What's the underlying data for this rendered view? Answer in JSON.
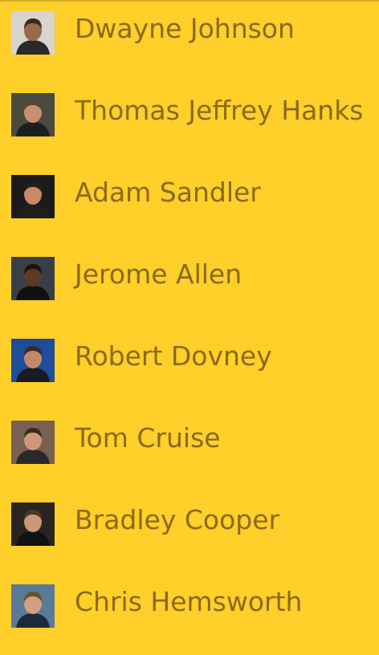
{
  "people": [
    {
      "name": "Dwayne Johnson",
      "bg": "#D8D4CE",
      "skin": "#9A6A4A",
      "hair": "#3A2A22",
      "shirt": "#2A2A2A",
      "avatar_icon": "person-photo-icon"
    },
    {
      "name": "Thomas Jeffrey Hanks",
      "bg": "#4A4A3E",
      "skin": "#C89070",
      "hair": "#5A4636",
      "shirt": "#1E1E22",
      "avatar_icon": "person-photo-icon"
    },
    {
      "name": "Adam Sandler",
      "bg": "#1A1A1A",
      "skin": "#C98A68",
      "hair": "#2A1E18",
      "shirt": "#1E1E1E",
      "avatar_icon": "person-photo-icon"
    },
    {
      "name": "Jerome Allen",
      "bg": "#3A3E46",
      "skin": "#5A3A28",
      "hair": "#1A1210",
      "shirt": "#101010",
      "avatar_icon": "person-photo-icon"
    },
    {
      "name": "Robert Dovney",
      "bg": "#1E4E9A",
      "skin": "#C08A6A",
      "hair": "#3A2A22",
      "shirt": "#1A1A22",
      "avatar_icon": "person-photo-icon"
    },
    {
      "name": "Tom Cruise",
      "bg": "#7A6050",
      "skin": "#D09878",
      "hair": "#3A2A1E",
      "shirt": "#2A2A2A",
      "avatar_icon": "person-photo-icon"
    },
    {
      "name": "Bradley Cooper",
      "bg": "#2A2420",
      "skin": "#C89878",
      "hair": "#4A3828",
      "shirt": "#121212",
      "avatar_icon": "person-photo-icon"
    },
    {
      "name": "Chris Hemsworth",
      "bg": "#5A7A9A",
      "skin": "#D0A080",
      "hair": "#6A5030",
      "shirt": "#1E2A3A",
      "avatar_icon": "person-photo-icon"
    }
  ]
}
